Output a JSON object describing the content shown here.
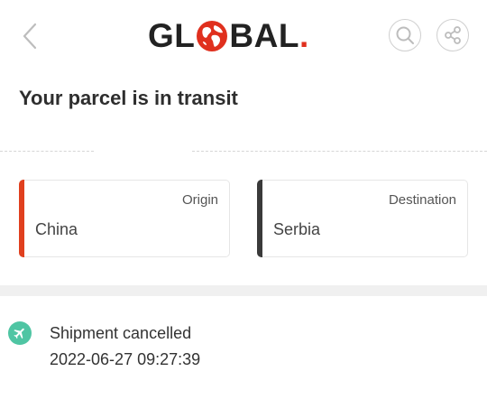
{
  "header": {
    "logo": {
      "part1": "GL",
      "part2": "BAL",
      "dot": "."
    },
    "icons": {
      "back": "chevron-left-icon",
      "search": "search-icon",
      "share": "share-icon"
    }
  },
  "parcel": {
    "title": "Your parcel is in transit",
    "origin": {
      "label": "Origin",
      "value": "China",
      "color": "#e0401e"
    },
    "destination": {
      "label": "Destination",
      "value": "Serbia",
      "color": "#3a3a3a"
    }
  },
  "events": [
    {
      "icon": "airplane-icon",
      "status": "Shipment cancelled",
      "time": "2022-06-27 09:27:39",
      "icon_color": "#4fc5a3"
    }
  ],
  "colors": {
    "brand": "#e0301e",
    "accent": "#4fc5a3"
  }
}
